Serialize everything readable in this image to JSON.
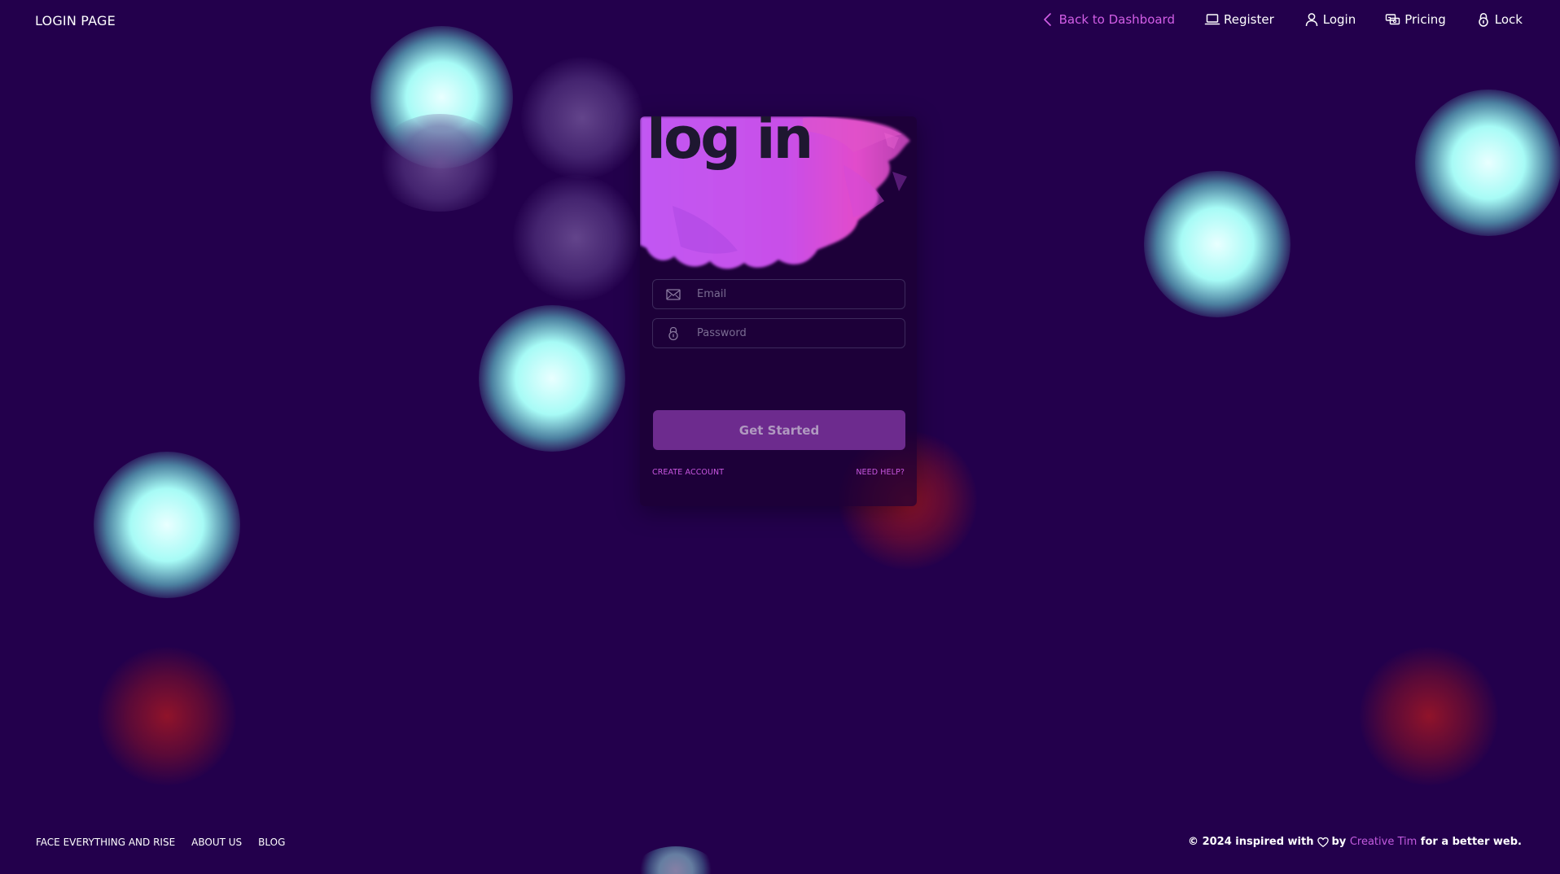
{
  "navbar": {
    "brand": "LOGIN PAGE",
    "items": [
      {
        "label": "Back to Dashboard",
        "icon": "chevron-left-icon"
      },
      {
        "label": "Register",
        "icon": "laptop-icon"
      },
      {
        "label": "Login",
        "icon": "user-icon"
      },
      {
        "label": "Pricing",
        "icon": "money-coins-icon"
      },
      {
        "label": "Lock",
        "icon": "lock-icon"
      }
    ]
  },
  "card": {
    "title": "log in",
    "email": {
      "placeholder": "Email",
      "value": "",
      "icon": "email-icon"
    },
    "password": {
      "placeholder": "Password",
      "value": "",
      "icon": "lock-icon"
    },
    "cta_label": "Get Started",
    "create_account": "CREATE ACCOUNT",
    "need_help": "NEED HELP?"
  },
  "footer": {
    "links": [
      "FACE EVERYTHING AND RISE",
      "ABOUT US",
      "BLOG"
    ],
    "copyright_prefix": "© 2024 inspired with",
    "copyright_by": "by",
    "copyright_brand": "Creative Tim",
    "copyright_suffix": "for a better web."
  },
  "colors": {
    "background": "#23004c",
    "accent_pink": "#d25ee6",
    "button": "#6d2b8e",
    "orb_cyan": "#a7fbf6",
    "orb_red": "#961428"
  }
}
